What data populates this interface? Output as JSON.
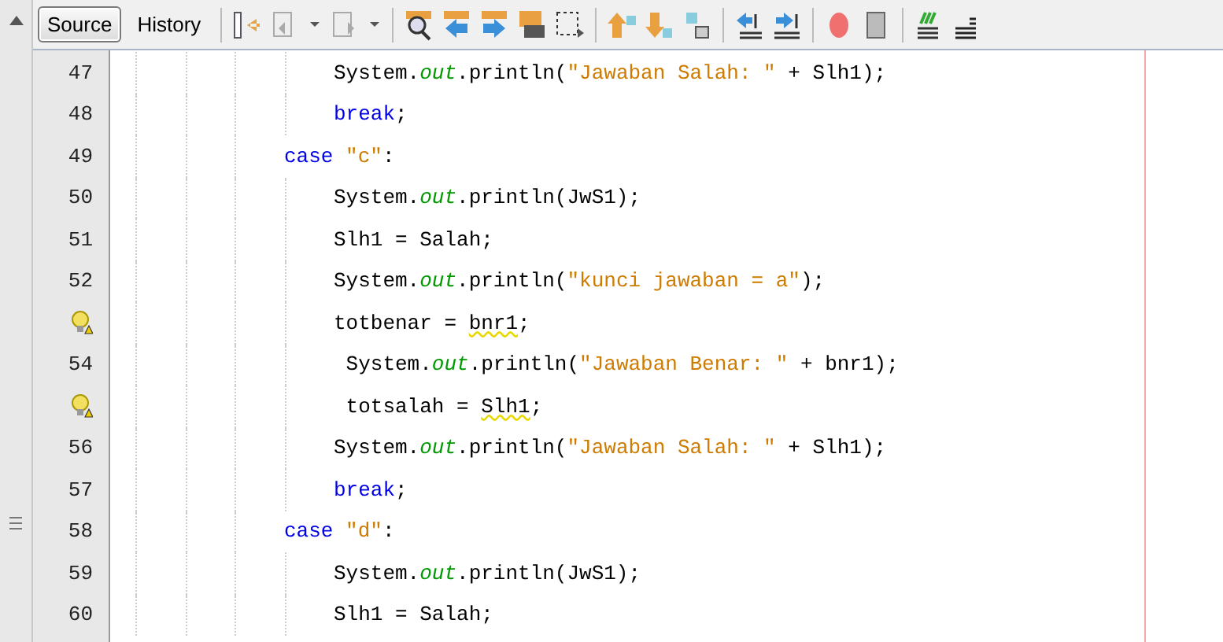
{
  "tabs": [
    {
      "label": "Source",
      "selected": true
    },
    {
      "label": "History",
      "selected": false
    }
  ],
  "toolbar": [
    {
      "kind": "last-edit"
    },
    {
      "kind": "back",
      "disabled": true
    },
    {
      "kind": "dropdown"
    },
    {
      "kind": "forward",
      "disabled": true
    },
    {
      "kind": "dropdown"
    },
    {
      "kind": "sep"
    },
    {
      "kind": "find"
    },
    {
      "kind": "find-prev"
    },
    {
      "kind": "find-next"
    },
    {
      "kind": "toggle-highlight"
    },
    {
      "kind": "select-rect"
    },
    {
      "kind": "sep"
    },
    {
      "kind": "bookmark-prev"
    },
    {
      "kind": "bookmark-next"
    },
    {
      "kind": "bookmark-toggle"
    },
    {
      "kind": "sep"
    },
    {
      "kind": "shift-left"
    },
    {
      "kind": "shift-right"
    },
    {
      "kind": "sep"
    },
    {
      "kind": "record"
    },
    {
      "kind": "stop"
    },
    {
      "kind": "sep"
    },
    {
      "kind": "comment"
    },
    {
      "kind": "uncomment"
    }
  ],
  "lines": [
    {
      "gutter": {
        "kind": "number",
        "text": "47"
      },
      "kind": "statement",
      "tokens": [
        {
          "kind": "plain",
          "text": "System."
        },
        {
          "kind": "field",
          "text": "out"
        },
        {
          "kind": "plain",
          "text": ".println("
        },
        {
          "kind": "string",
          "text": "\"Jawaban Salah: \""
        },
        {
          "kind": "plain",
          "text": " + Slh1);"
        }
      ]
    },
    {
      "gutter": {
        "kind": "number",
        "text": "48"
      },
      "kind": "statement",
      "tokens": [
        {
          "kind": "keyword",
          "text": "break"
        },
        {
          "kind": "plain",
          "text": ";"
        }
      ]
    },
    {
      "gutter": {
        "kind": "number",
        "text": "49"
      },
      "kind": "case",
      "tokens": [
        {
          "kind": "keyword",
          "text": "case"
        },
        {
          "kind": "string",
          "text": " \"c\""
        },
        {
          "kind": "plain",
          "text": ":"
        }
      ]
    },
    {
      "gutter": {
        "kind": "number",
        "text": "50"
      },
      "kind": "statement",
      "tokens": [
        {
          "kind": "plain",
          "text": "System."
        },
        {
          "kind": "field",
          "text": "out"
        },
        {
          "kind": "plain",
          "text": ".println(JwS1);"
        }
      ]
    },
    {
      "gutter": {
        "kind": "number",
        "text": "51"
      },
      "kind": "statement",
      "tokens": [
        {
          "kind": "plain",
          "text": "Slh1 = Salah;"
        }
      ]
    },
    {
      "gutter": {
        "kind": "number",
        "text": "52"
      },
      "kind": "statement",
      "tokens": [
        {
          "kind": "plain",
          "text": "System."
        },
        {
          "kind": "field",
          "text": "out"
        },
        {
          "kind": "plain",
          "text": ".println("
        },
        {
          "kind": "string",
          "text": "\"kunci jawaban = a\""
        },
        {
          "kind": "plain",
          "text": ");"
        }
      ]
    },
    {
      "gutter": {
        "kind": "hint"
      },
      "kind": "statement",
      "tokens": [
        {
          "kind": "plain",
          "text": "totbenar = "
        },
        {
          "kind": "warning",
          "text": "bnr1"
        },
        {
          "kind": "plain",
          "text": ";"
        }
      ]
    },
    {
      "gutter": {
        "kind": "number",
        "text": "54"
      },
      "kind": "statement",
      "tokens": [
        {
          "kind": "plain",
          "text": " System."
        },
        {
          "kind": "field",
          "text": "out"
        },
        {
          "kind": "plain",
          "text": ".println("
        },
        {
          "kind": "string",
          "text": "\"Jawaban Benar: \""
        },
        {
          "kind": "plain",
          "text": " + bnr1);"
        }
      ]
    },
    {
      "gutter": {
        "kind": "hint"
      },
      "kind": "statement",
      "tokens": [
        {
          "kind": "plain",
          "text": " totsalah = "
        },
        {
          "kind": "warning",
          "text": "Slh1"
        },
        {
          "kind": "plain",
          "text": ";"
        }
      ]
    },
    {
      "gutter": {
        "kind": "number",
        "text": "56"
      },
      "kind": "statement",
      "tokens": [
        {
          "kind": "plain",
          "text": "System."
        },
        {
          "kind": "field",
          "text": "out"
        },
        {
          "kind": "plain",
          "text": ".println("
        },
        {
          "kind": "string",
          "text": "\"Jawaban Salah: \""
        },
        {
          "kind": "plain",
          "text": " + Slh1);"
        }
      ]
    },
    {
      "gutter": {
        "kind": "number",
        "text": "57"
      },
      "kind": "statement",
      "tokens": [
        {
          "kind": "keyword",
          "text": "break"
        },
        {
          "kind": "plain",
          "text": ";"
        }
      ]
    },
    {
      "gutter": {
        "kind": "number",
        "text": "58"
      },
      "kind": "case",
      "tokens": [
        {
          "kind": "keyword",
          "text": "case"
        },
        {
          "kind": "string",
          "text": " \"d\""
        },
        {
          "kind": "plain",
          "text": ":"
        }
      ]
    },
    {
      "gutter": {
        "kind": "number",
        "text": "59"
      },
      "kind": "statement",
      "tokens": [
        {
          "kind": "plain",
          "text": "System."
        },
        {
          "kind": "field",
          "text": "out"
        },
        {
          "kind": "plain",
          "text": ".println(JwS1);"
        }
      ]
    },
    {
      "gutter": {
        "kind": "number",
        "text": "60"
      },
      "kind": "statement",
      "tokens": [
        {
          "kind": "plain",
          "text": "Slh1 = Salah;"
        }
      ]
    }
  ]
}
